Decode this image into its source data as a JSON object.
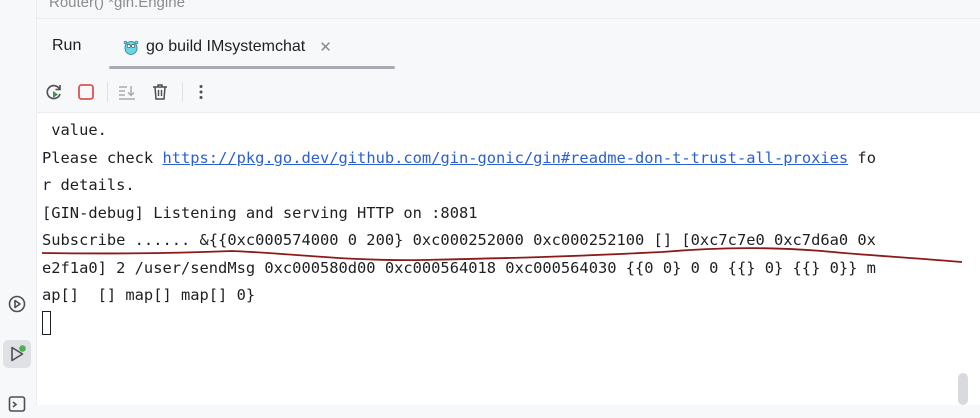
{
  "editor": {
    "partial_line": "Router() *gin.Engine"
  },
  "run_window": {
    "title": "Run",
    "tab": {
      "label": "go build IMsystemchat",
      "icon": "gopher-icon",
      "close": "✕"
    }
  },
  "toolbar": {
    "buttons": [
      {
        "name": "rerun-icon"
      },
      {
        "name": "stop-icon"
      },
      {
        "name": "scroll-to-end-icon"
      },
      {
        "name": "clear-all-icon"
      },
      {
        "name": "more-options-icon"
      }
    ]
  },
  "console": {
    "lines": [
      " value.",
      "Please check ",
      "https://pkg.go.dev/github.com/gin-gonic/gin#readme-don-t-trust-all-proxies",
      " fo",
      "r details.",
      "[GIN-debug] Listening and serving HTTP on :8081",
      "Subscribe ...... &{{0xc000574000 0 200} 0xc000252000 0xc000252100 [] [0xc7c7e0 0xc7d6a0 0x",
      "e2f1a0] 2 /user/sendMsg 0xc000580d00 0xc000564018 0xc000564030 {{0 0} 0 0 {{} 0} {{} 0}} m",
      "ap[]  [] map[] map[] 0}"
    ]
  },
  "colors": {
    "link": "#2a5fd6",
    "stop": "#e0524f",
    "rerun": "#4a8f4a",
    "annotation": "#8b1a1a"
  }
}
